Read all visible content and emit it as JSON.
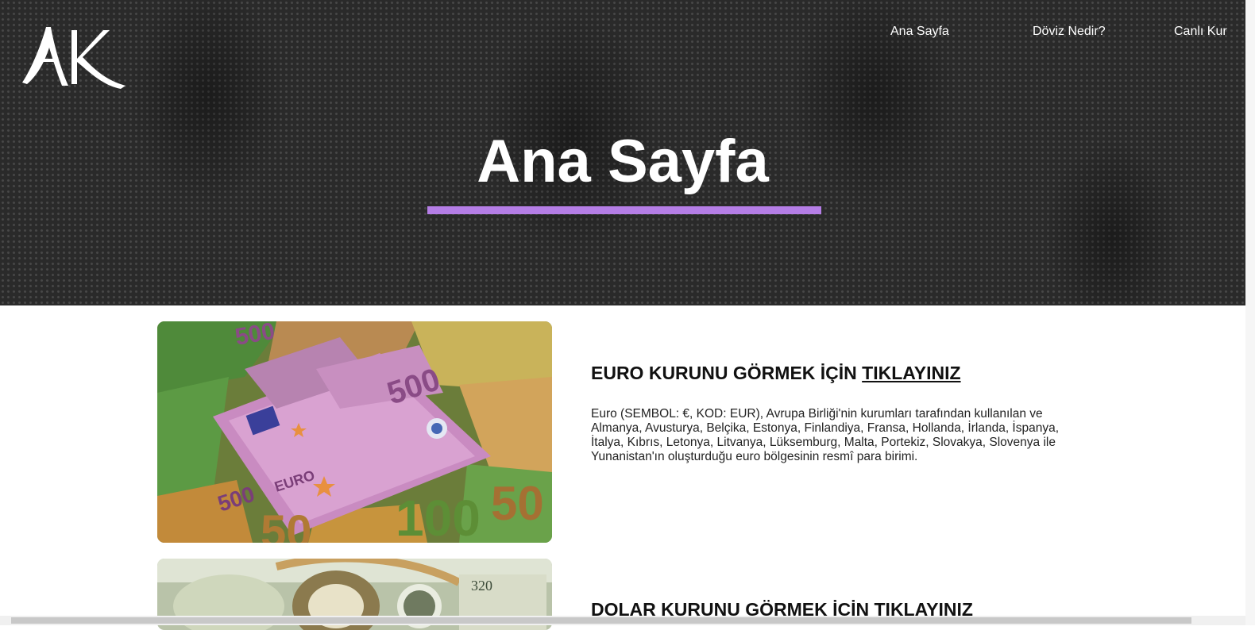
{
  "header": {
    "logo_text": "AK",
    "nav": [
      "Ana Sayfa",
      "Döviz Nedir?",
      "Canlı Kur"
    ]
  },
  "hero": {
    "title": "Ana Sayfa",
    "accent_color": "#b57ee6"
  },
  "cards": [
    {
      "title_prefix": "EURO KURUNU GÖRMEK İÇİN ",
      "title_link": "TIKLAYINIZ",
      "description": "Euro (SEMBOL: €, KOD: EUR), Avrupa Birliği'nin kurumları tarafından kullanılan ve Almanya, Avusturya, Belçika, Estonya, Finlandiya, Fransa, Hollanda, İrlanda, İspanya, İtalya, Kıbrıs, Letonya, Litvanya, Lüksemburg, Malta, Portekiz, Slovakya, Slovenya ile Yunanistan'ın oluşturduğu euro bölgesinin resmî para birimi.",
      "image_icon": "euro-banknotes-image"
    },
    {
      "title_prefix": "DOLAR KURUNU GÖRMEK İÇİN ",
      "title_link": "TIKLAYINIZ",
      "image_icon": "dollar-banknotes-image"
    }
  ]
}
